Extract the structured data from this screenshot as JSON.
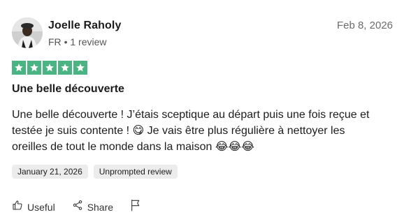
{
  "reviewer": {
    "name": "Joelle Raholy",
    "country": "FR",
    "separator": "•",
    "review_count": "1 review"
  },
  "review": {
    "date": "Feb 8, 2026",
    "rating": 5,
    "title": "Une belle découverte",
    "body": "Une belle découverte ! J’étais sceptique au départ puis une fois reçue et testée je suis contente ! 😋 Je vais être plus régulière à nettoyer les oreilles de tout le monde dans la maison 😂😂😂",
    "experience_date": "January 21, 2026",
    "badge": "Unprompted review"
  },
  "actions": {
    "useful_label": "Useful",
    "share_label": "Share"
  },
  "colors": {
    "star_green": "#4bb483",
    "tag_bg": "#ececec"
  },
  "icons": {
    "useful": "thumbs-up-icon",
    "share": "share-icon",
    "flag": "flag-icon",
    "star": "star-icon"
  }
}
